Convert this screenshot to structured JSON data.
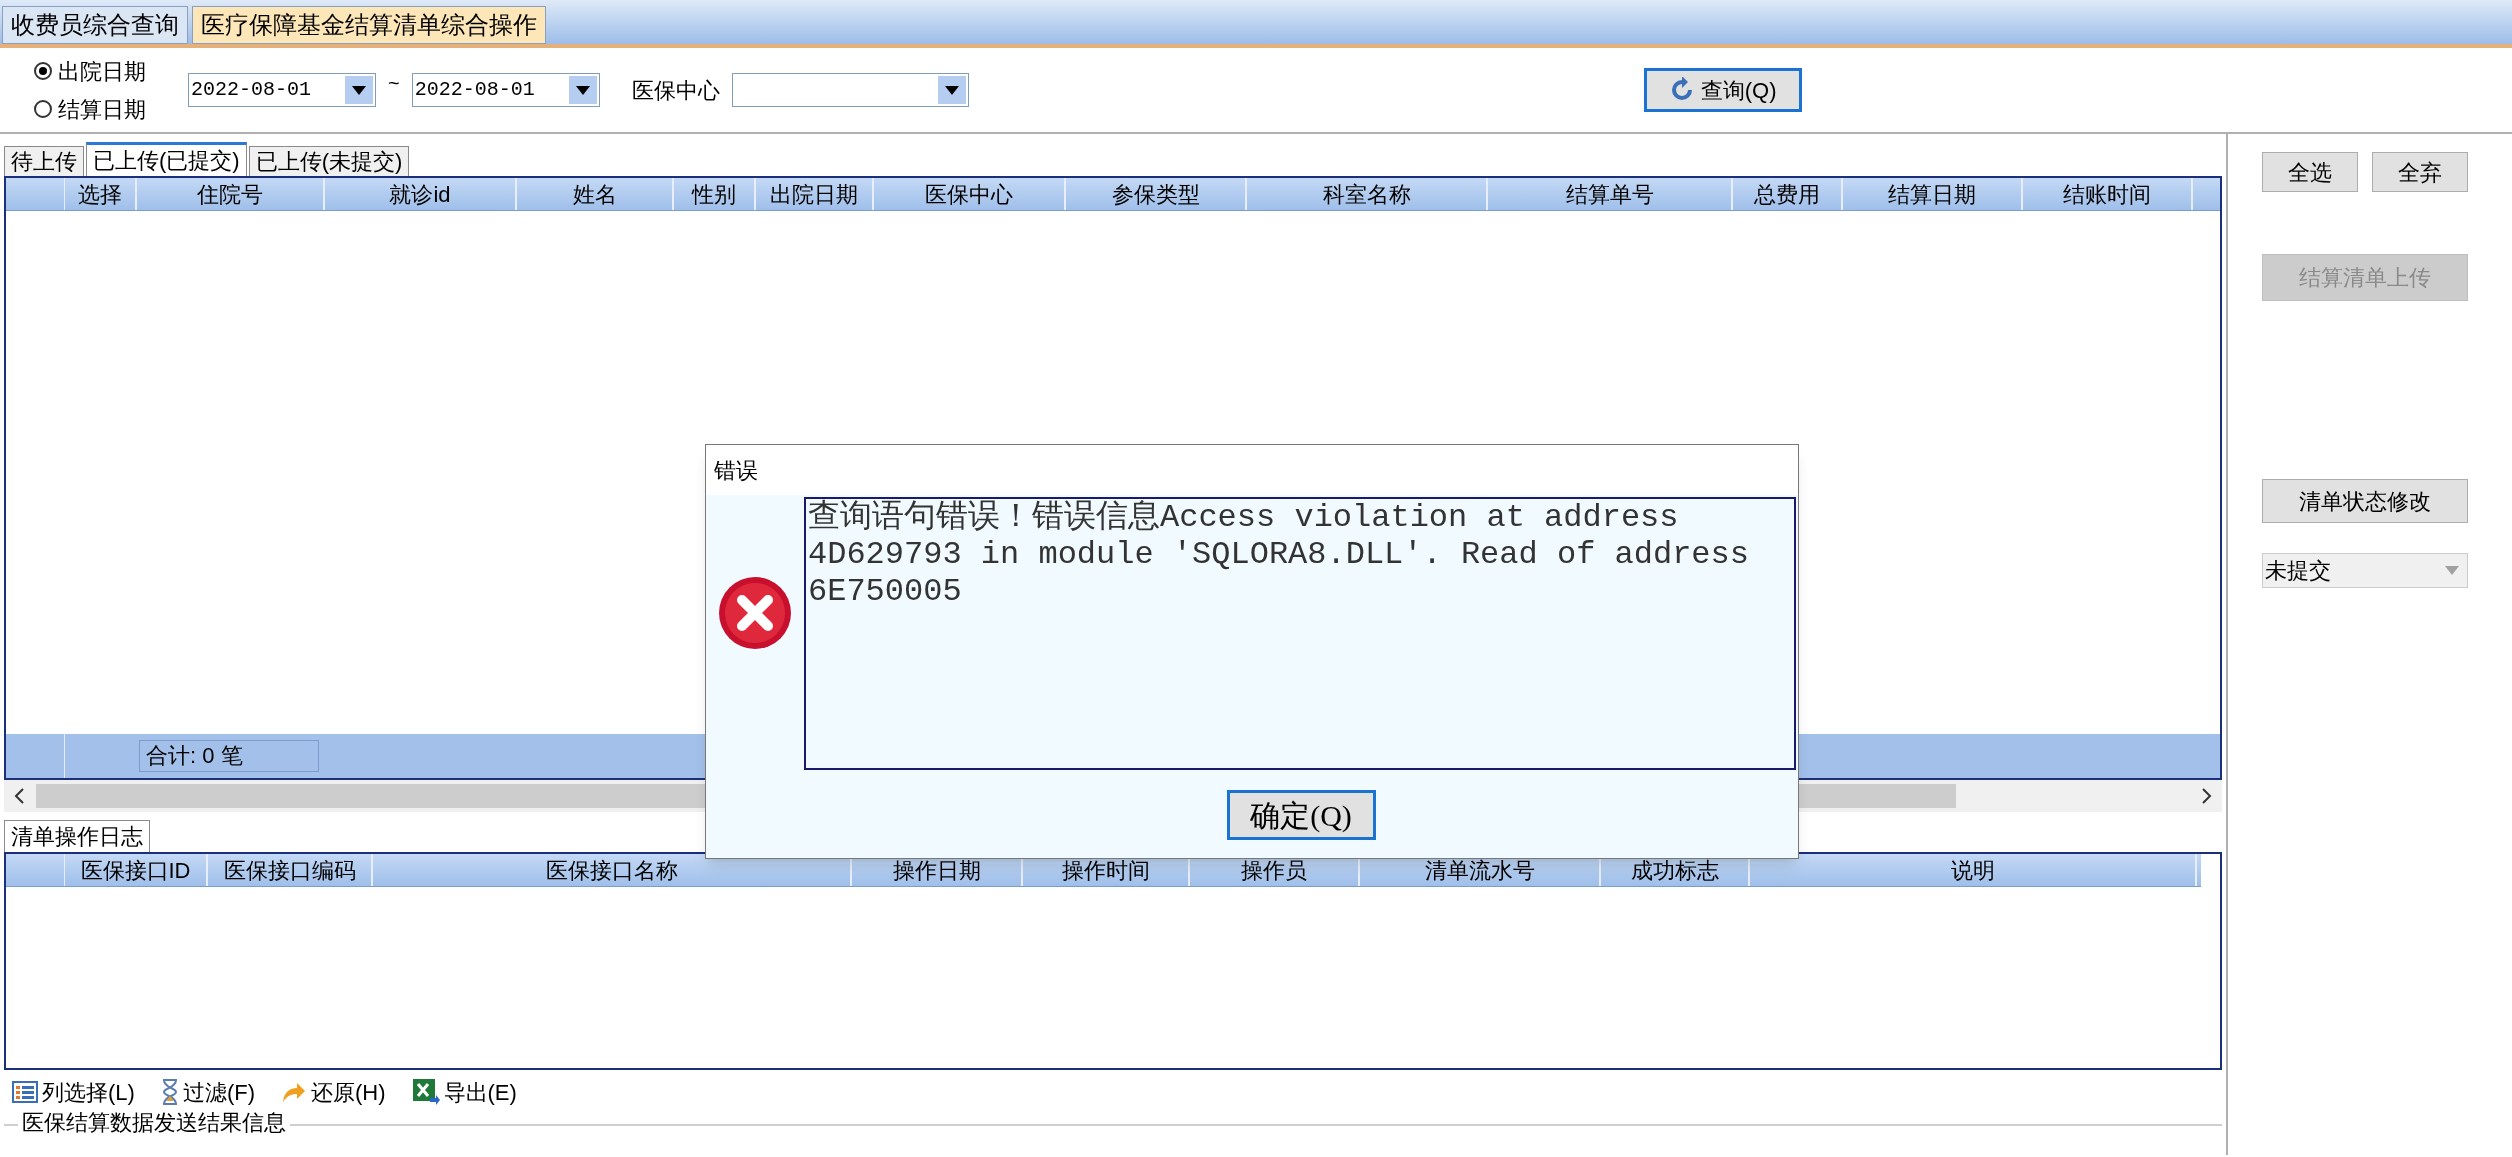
{
  "module_tabs": [
    {
      "label": "收费员综合查询",
      "selected": false
    },
    {
      "label": "医疗保障基金结算清单综合操作",
      "selected": true
    }
  ],
  "filter": {
    "date_types": [
      {
        "label": "出院日期",
        "selected": true
      },
      {
        "label": "结算日期",
        "selected": false
      }
    ],
    "date_from": "2022-08-01",
    "separator": "~",
    "date_to": "2022-08-01",
    "center_label": "医保中心",
    "query_button": "查询(Q)"
  },
  "grid_tabs": [
    {
      "label": "待上传",
      "selected": false
    },
    {
      "label": "已上传(已提交)",
      "selected": true
    },
    {
      "label": "已上传(未提交)",
      "selected": false
    }
  ],
  "grid": {
    "columns": [
      "选择",
      "住院号",
      "就诊id",
      "姓名",
      "性别",
      "出院日期",
      "医保中心",
      "参保类型",
      "科室名称",
      "结算单号",
      "总费用",
      "结算日期",
      "结账时间"
    ],
    "total": "合计: 0 笔"
  },
  "log_tab": "清单操作日志",
  "log": {
    "columns": [
      "医保接口ID",
      "医保接口编码",
      "医保接口名称",
      "操作日期",
      "操作时间",
      "操作员",
      "清单流水号",
      "成功标志",
      "说明"
    ]
  },
  "toolbar": [
    {
      "kind": "columns",
      "label": "列选择(L)"
    },
    {
      "kind": "filter",
      "label": "过滤(F)"
    },
    {
      "kind": "restore",
      "label": "还原(H)"
    },
    {
      "kind": "export",
      "label": "导出(E)"
    }
  ],
  "result_group": "医保结算数据发送结果信息",
  "side": {
    "select_all": "全选",
    "deselect_all": "全弃",
    "upload": {
      "label": "结算清单上传",
      "disabled": true
    },
    "status_button": "清单状态修改",
    "status_value": "未提交"
  },
  "dialog": {
    "title": "错误",
    "message": "查询语句错误！错误信息Access violation at address 4D629793 in module 'SQLORA8.DLL'. Read of address 6E750005",
    "ok": "确定(Q)"
  }
}
